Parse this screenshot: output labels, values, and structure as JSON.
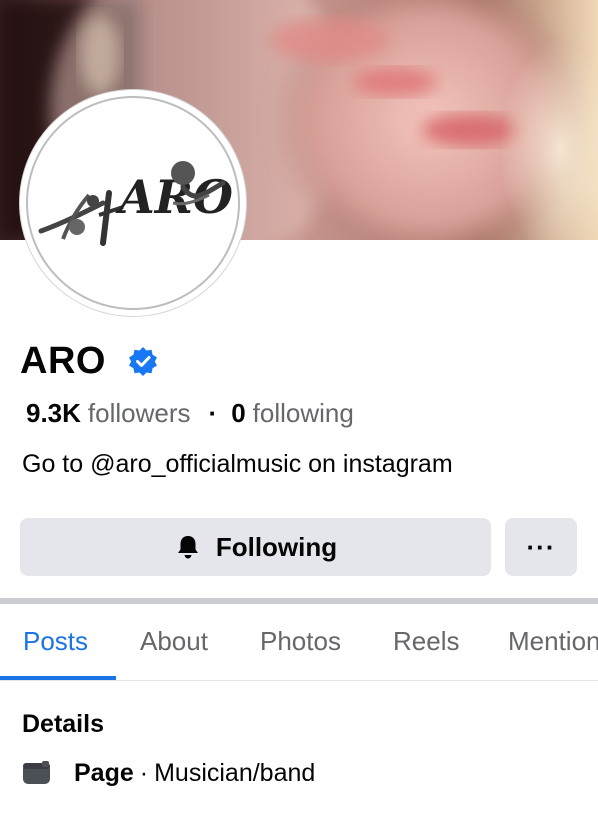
{
  "profile": {
    "name": "ARO",
    "avatar_text": "ARO",
    "followers_count": "9.3K",
    "followers_label": "followers",
    "separator": "·",
    "following_count": "0",
    "following_label": "following",
    "bio": "Go to @aro_officialmusic on instagram"
  },
  "actions": {
    "following_label": "Following",
    "more_label": "···"
  },
  "tabs": [
    {
      "label": "Posts",
      "active": true
    },
    {
      "label": "About",
      "active": false
    },
    {
      "label": "Photos",
      "active": false
    },
    {
      "label": "Reels",
      "active": false
    },
    {
      "label": "Mentions",
      "active": false
    }
  ],
  "details": {
    "title": "Details",
    "type_label": "Page",
    "separator": "·",
    "category": "Musician/band"
  },
  "colors": {
    "accent": "#1b74e4",
    "verified": "#1877f2",
    "button_bg": "#e4e6eb",
    "secondary_text": "#65676b"
  },
  "icons": {
    "verified": "verified-badge-icon",
    "bell": "bell-icon",
    "more": "more-options-icon",
    "page": "page-icon"
  }
}
